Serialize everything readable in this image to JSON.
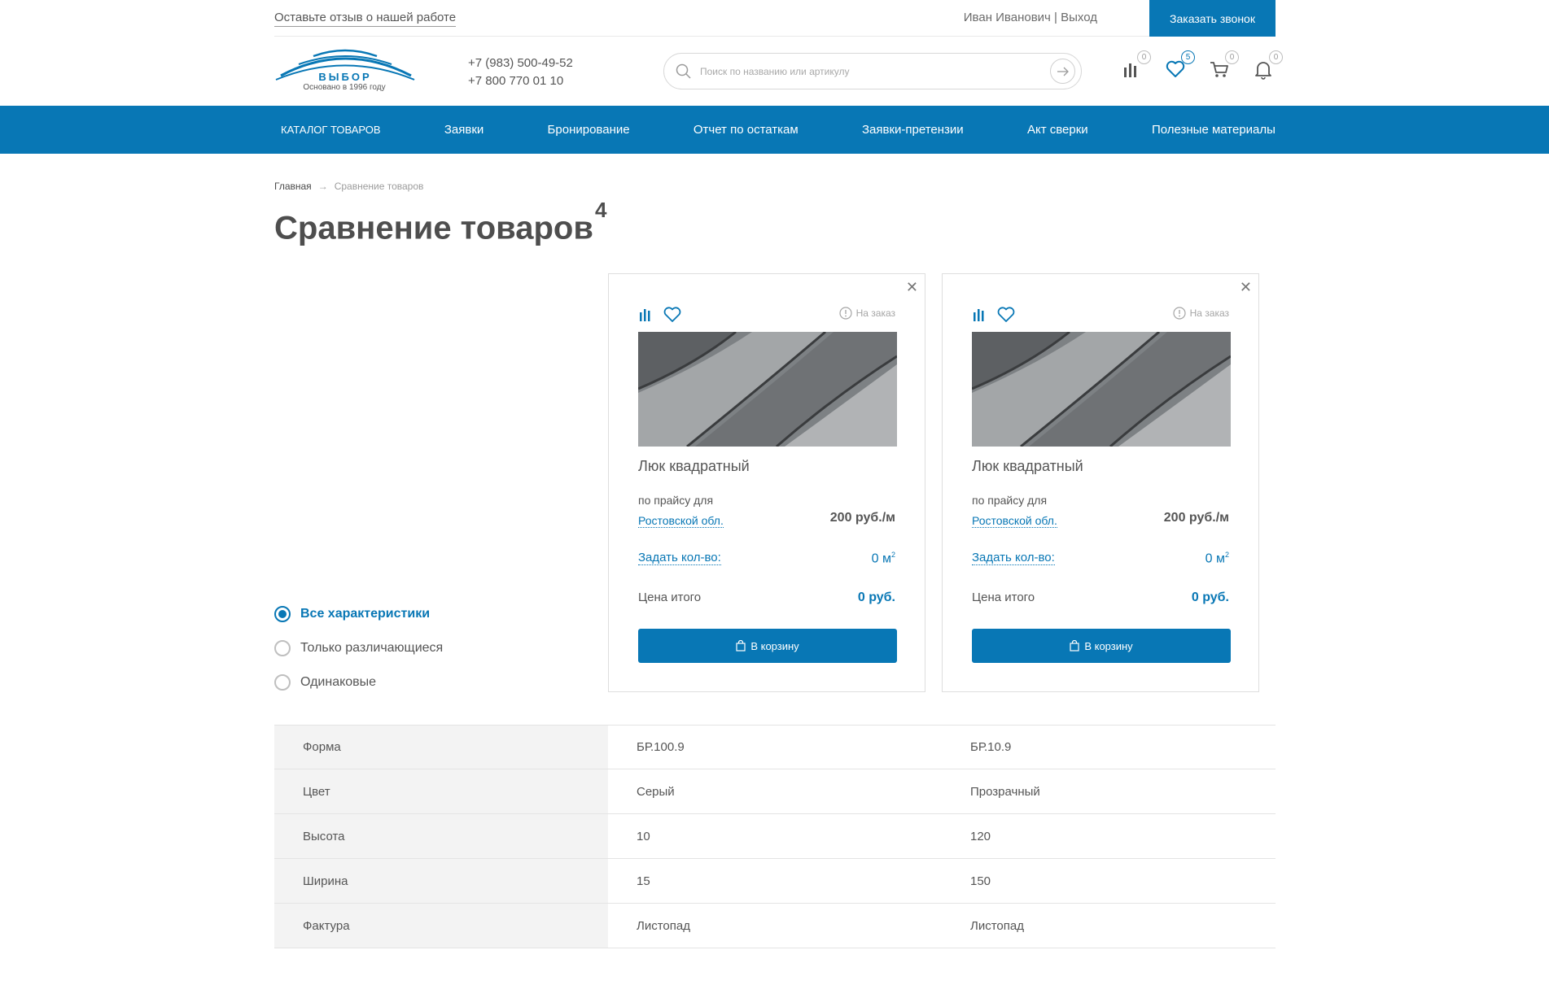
{
  "topbar": {
    "feedback": "Оставьте отзыв о нашей работе",
    "user_name": "Иван Иванович",
    "separator": "|",
    "logout": "Выход",
    "call_button": "Заказать звонок"
  },
  "header": {
    "logo_word": "ВЫБОР",
    "logo_tagline": "Основано в 1996 году",
    "phone1": "+7 (983) 500-49-52",
    "phone2": "+7 800 770 01 10",
    "search_placeholder": "Поиск по названию или артикулу",
    "counters": {
      "compare": "0",
      "favorites": "5",
      "cart": "0",
      "notifications": "0"
    }
  },
  "nav": {
    "items": [
      "КАТАЛОГ ТОВАРОВ",
      "Заявки",
      "Бронирование",
      "Отчет по остаткам",
      "Заявки-претензии",
      "Акт сверки",
      "Полезные материалы"
    ]
  },
  "breadcrumb": {
    "home": "Главная",
    "arrow": "→",
    "current": "Сравнение товаров"
  },
  "title": {
    "text": "Сравнение товаров",
    "count": "4"
  },
  "filters": [
    "Все характеристики",
    "Только различающиеся",
    "Одинаковые"
  ],
  "products": [
    {
      "availability": "На заказ",
      "name": "Люк квадратный",
      "price_for": "по прайсу для",
      "region": "Ростовской обл.",
      "price": "200 руб./м",
      "qty_link": "Задать кол-во:",
      "qty_value": "0 м",
      "qty_unit_sup": "2",
      "total_label": "Цена итого",
      "total_value": "0 руб.",
      "buy_label": "В корзину"
    },
    {
      "availability": "На заказ",
      "name": "Люк квадратный",
      "price_for": "по прайсу для",
      "region": "Ростовской обл.",
      "price": "200 руб./м",
      "qty_link": "Задать кол-во:",
      "qty_value": "0 м",
      "qty_unit_sup": "2",
      "total_label": "Цена итого",
      "total_value": "0 руб.",
      "buy_label": "В корзину"
    }
  ],
  "specs": [
    {
      "label": "Форма",
      "v1": "БР.100.9",
      "v2": "БР.10.9"
    },
    {
      "label": "Цвет",
      "v1": "Серый",
      "v2": "Прозрачный"
    },
    {
      "label": "Высота",
      "v1": "10",
      "v2": "120"
    },
    {
      "label": "Ширина",
      "v1": "15",
      "v2": "150"
    },
    {
      "label": "Фактура",
      "v1": "Листопад",
      "v2": "Листопад"
    }
  ],
  "colors": {
    "accent": "#0877b5",
    "text": "#4a4a4a",
    "muted": "#9c9c9c",
    "row_label_bg": "#f3f3f3"
  }
}
